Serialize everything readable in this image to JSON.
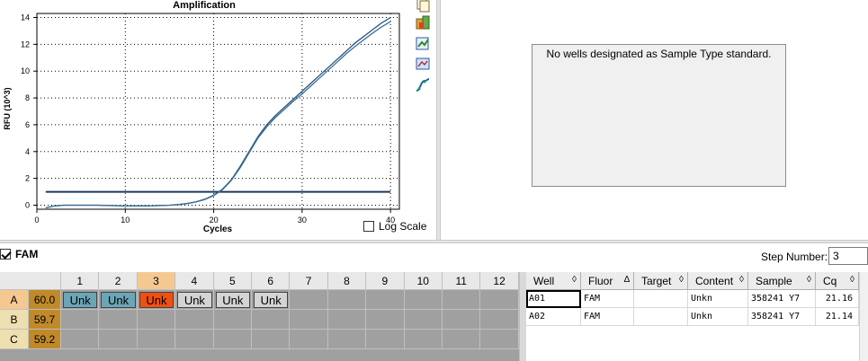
{
  "chart_data": {
    "type": "line",
    "title": "Amplification",
    "xlabel": "Cycles",
    "ylabel": "RFU (10^3)",
    "xlim": [
      0,
      41
    ],
    "ylim": [
      -0.3,
      14.3
    ],
    "xticks": [
      0,
      10,
      20,
      30,
      40
    ],
    "yticks": [
      0,
      2,
      4,
      6,
      8,
      10,
      12,
      14
    ],
    "grid": true,
    "threshold": 1.0,
    "series": [
      {
        "x": [
          1,
          2,
          3,
          4,
          5,
          6,
          7,
          8,
          9,
          10,
          11,
          12,
          13,
          14,
          15,
          16,
          17,
          18,
          19,
          20,
          21,
          22,
          23,
          24,
          25,
          26,
          27,
          28,
          29,
          30,
          31,
          32,
          33,
          34,
          35,
          36,
          37,
          38,
          39,
          40
        ],
        "values": [
          -0.2,
          -0.05,
          0.0,
          0.0,
          0.0,
          0.0,
          0.0,
          -0.02,
          -0.03,
          -0.05,
          -0.05,
          -0.05,
          -0.04,
          -0.02,
          0.0,
          0.05,
          0.12,
          0.25,
          0.45,
          0.75,
          1.2,
          1.9,
          2.9,
          4.0,
          5.1,
          6.0,
          6.7,
          7.3,
          7.9,
          8.5,
          9.1,
          9.7,
          10.3,
          10.9,
          11.5,
          12.1,
          12.6,
          13.1,
          13.6,
          14.0
        ]
      },
      {
        "x": [
          1,
          2,
          3,
          4,
          5,
          6,
          7,
          8,
          9,
          10,
          11,
          12,
          13,
          14,
          15,
          16,
          17,
          18,
          19,
          20,
          21,
          22,
          23,
          24,
          25,
          26,
          27,
          28,
          29,
          30,
          31,
          32,
          33,
          34,
          35,
          36,
          37,
          38,
          39,
          40
        ],
        "values": [
          -0.2,
          -0.05,
          0.0,
          0.0,
          0.0,
          0.0,
          0.0,
          -0.02,
          -0.03,
          -0.05,
          -0.05,
          -0.05,
          -0.04,
          -0.02,
          0.0,
          0.05,
          0.12,
          0.24,
          0.43,
          0.72,
          1.15,
          1.85,
          2.8,
          3.9,
          5.0,
          5.85,
          6.55,
          7.15,
          7.75,
          8.3,
          8.9,
          9.5,
          10.1,
          10.7,
          11.3,
          11.85,
          12.35,
          12.85,
          13.3,
          13.7
        ]
      }
    ]
  },
  "toolbar_icons": [
    "copy-icon",
    "export-icon",
    "add-chart-icon",
    "chart-settings-icon",
    "curve-icon"
  ],
  "log_scale": {
    "label": "Log Scale",
    "checked": false
  },
  "standard_curve": {
    "message": "No wells designated as Sample Type standard."
  },
  "fluor": {
    "label": "FAM",
    "checked": true
  },
  "step": {
    "label": "Step Number:",
    "value": "3"
  },
  "plate": {
    "columns": [
      "1",
      "2",
      "3",
      "4",
      "5",
      "6",
      "7",
      "8",
      "9",
      "10",
      "11",
      "12"
    ],
    "rows": [
      {
        "label": "A",
        "temp": "60.0"
      },
      {
        "label": "B",
        "temp": "59.7"
      },
      {
        "label": "C",
        "temp": "59.2"
      }
    ],
    "wells": [
      {
        "row": 0,
        "col": 0,
        "text": "Unk",
        "color": "#6aa6b8"
      },
      {
        "row": 0,
        "col": 1,
        "text": "Unk",
        "color": "#6aa6b8"
      },
      {
        "row": 0,
        "col": 2,
        "text": "Unk",
        "color": "#f04f10"
      },
      {
        "row": 0,
        "col": 3,
        "text": "Unk",
        "color": "#d4d4d4"
      },
      {
        "row": 0,
        "col": 4,
        "text": "Unk",
        "color": "#d4d4d4"
      },
      {
        "row": 0,
        "col": 5,
        "text": "Unk",
        "color": "#d4d4d4"
      }
    ],
    "selected_column": 2,
    "selected_row": 0
  },
  "well_table": {
    "headers": [
      "Well",
      "Fluor",
      "Target",
      "Content",
      "Sample",
      "Cq"
    ],
    "rows": [
      [
        "A01",
        "FAM",
        "",
        "Unkn",
        "358241 Y7",
        "21.16"
      ],
      [
        "A02",
        "FAM",
        "",
        "Unkn",
        "358241 Y7",
        "21.14"
      ]
    ]
  }
}
